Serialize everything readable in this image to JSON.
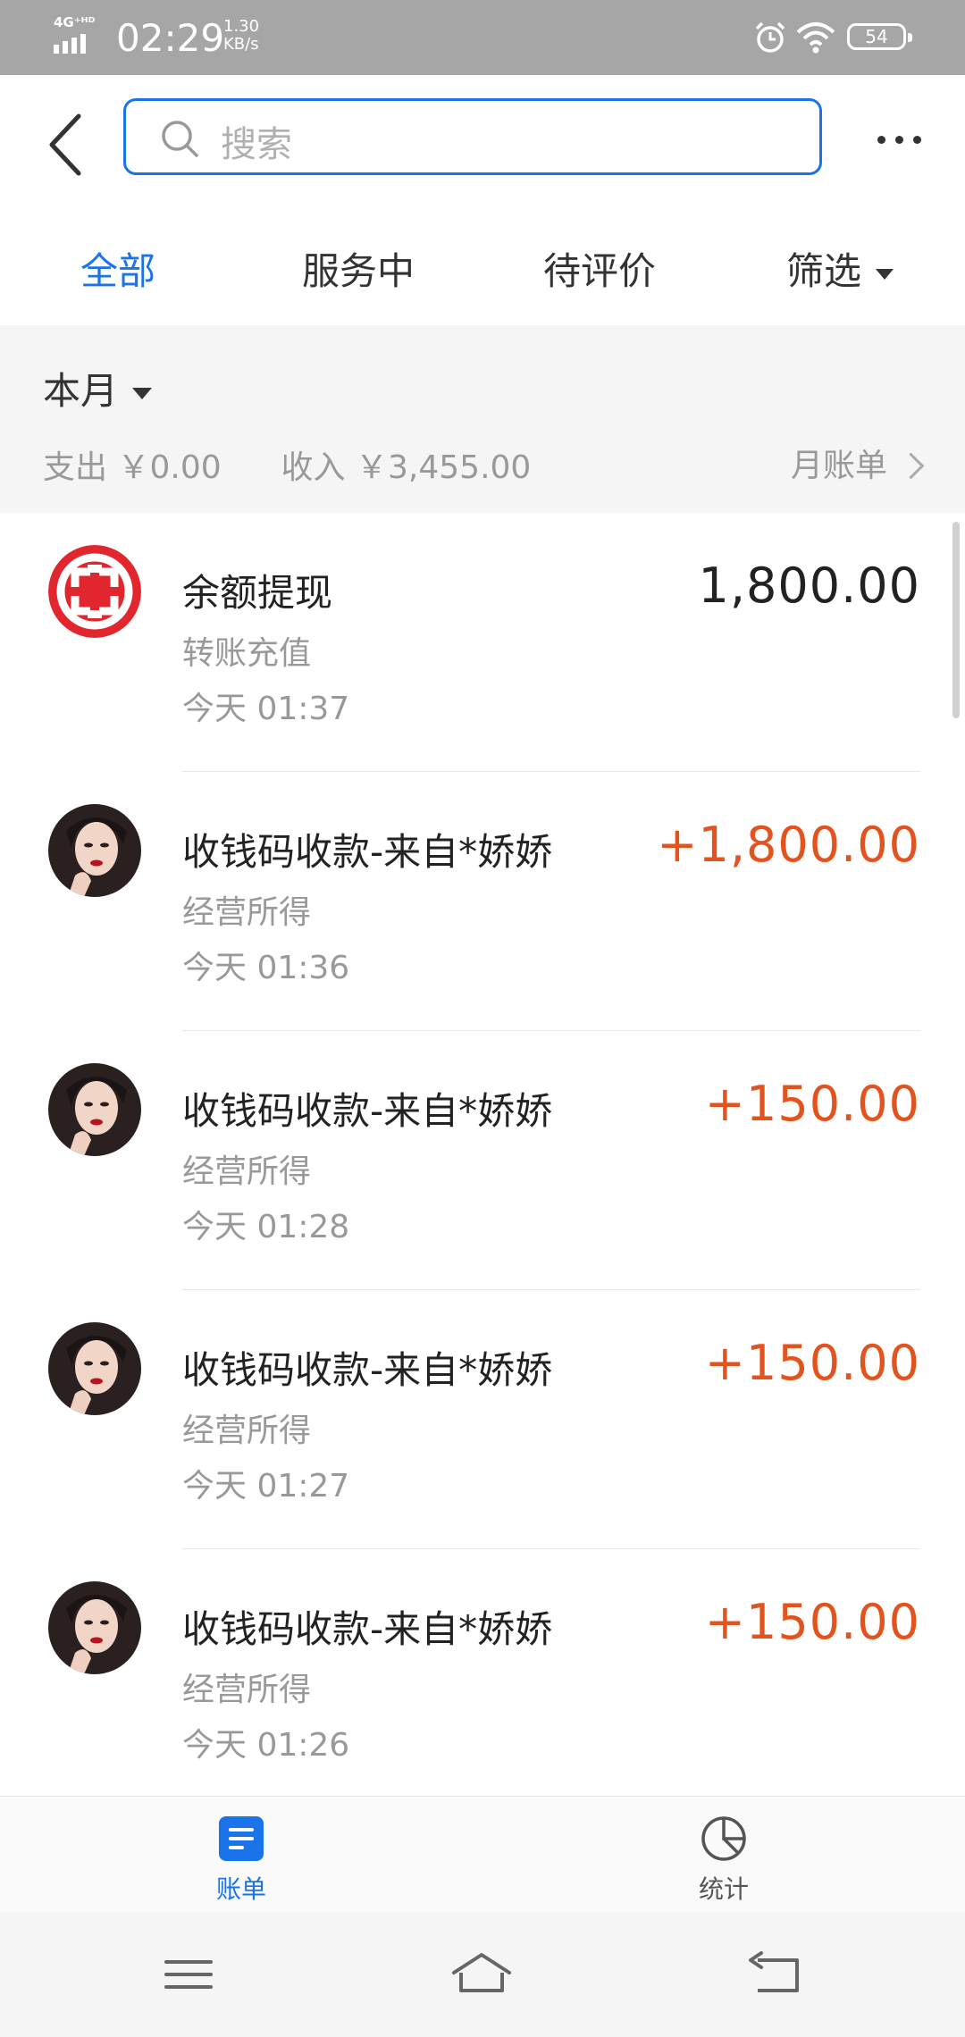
{
  "status_bar": {
    "network": "4G⁺ᴴᴰ",
    "time": "02:29",
    "speed_value": "1.30",
    "speed_unit": "KB/s",
    "battery": "54"
  },
  "search": {
    "placeholder": "搜索"
  },
  "tabs": [
    {
      "label": "全部",
      "active": true
    },
    {
      "label": "服务中",
      "active": false
    },
    {
      "label": "待评价",
      "active": false
    },
    {
      "label": "筛选",
      "active": false
    }
  ],
  "summary": {
    "month": "本月",
    "expense_label": "支出",
    "expense_value": "￥0.00",
    "income_label": "收入",
    "income_value": "￥3,455.00",
    "monthly_bill": "月账单"
  },
  "transactions": [
    {
      "title": "余额提现",
      "subtitle": "转账充值",
      "time": "今天  01:37",
      "amount": "1,800.00",
      "icon": "bank-logo-icon",
      "income": false
    },
    {
      "title": "收钱码收款-来自*娇娇",
      "subtitle": "经营所得",
      "time": "今天  01:36",
      "amount": "+1,800.00",
      "icon": "user-avatar",
      "income": true
    },
    {
      "title": "收钱码收款-来自*娇娇",
      "subtitle": "经营所得",
      "time": "今天  01:28",
      "amount": "+150.00",
      "icon": "user-avatar",
      "income": true
    },
    {
      "title": "收钱码收款-来自*娇娇",
      "subtitle": "经营所得",
      "time": "今天  01:27",
      "amount": "+150.00",
      "icon": "user-avatar",
      "income": true
    },
    {
      "title": "收钱码收款-来自*娇娇",
      "subtitle": "经营所得",
      "time": "今天  01:26",
      "amount": "+150.00",
      "icon": "user-avatar",
      "income": true
    }
  ],
  "bottom_nav": [
    {
      "label": "账单",
      "icon": "bill-icon",
      "active": true
    },
    {
      "label": "统计",
      "icon": "pie-chart-icon",
      "active": false
    }
  ],
  "colors": {
    "accent": "#1a73e8",
    "income": "#e2531e",
    "bank_red": "#e1262d"
  }
}
